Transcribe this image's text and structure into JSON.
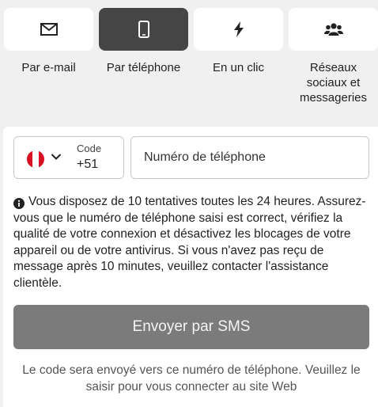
{
  "tabs": [
    {
      "label": "Par e-mail",
      "icon": "envelope-icon",
      "active": false
    },
    {
      "label": "Par téléphone",
      "icon": "mobile-phone-icon",
      "active": true
    },
    {
      "label": "En un clic",
      "icon": "lightning-bolt-icon",
      "active": false
    },
    {
      "label": "Réseaux sociaux et messageries",
      "icon": "users-group-icon",
      "active": false
    }
  ],
  "phone_form": {
    "country_flag": "peru-flag",
    "code_label": "Code",
    "code_value": "+51",
    "phone_placeholder": "Numéro de téléphone",
    "phone_value": ""
  },
  "info_message": "Vous disposez de 10 tentatives toutes les 24 heures. Assurez-vous que le numéro de téléphone saisi est correct, vérifiez la qualité de votre connexion et désactivez les blocages de votre appareil ou de votre antivirus. Si vous n'avez pas reçu de message après 10 minutes, veuillez contacter l'assistance clientèle.",
  "submit_label": "Envoyer par SMS",
  "footer_note": "Le code sera envoyé vers ce numéro de téléphone. Veuillez le saisir pour vous connecter au site Web",
  "colors": {
    "active_tab": "#454545",
    "button_disabled": "#7b7b7b",
    "page_background": "#f0f0f0"
  }
}
